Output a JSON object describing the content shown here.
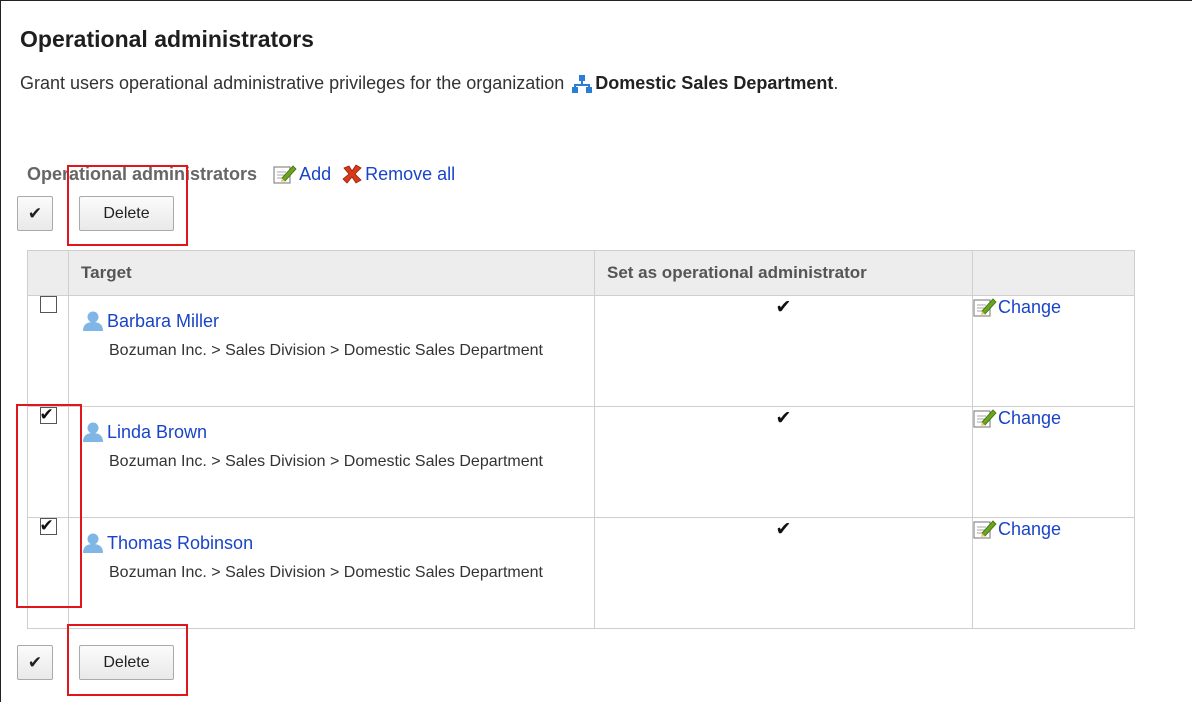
{
  "page": {
    "title": "Operational administrators",
    "description": "Grant users operational administrative privileges for the organization",
    "organization": "Domestic Sales Department",
    "description_end": "."
  },
  "section": {
    "label": "Operational administrators",
    "add_label": "Add",
    "remove_all_label": "Remove all"
  },
  "toolbar": {
    "select_all_label": "✔",
    "delete_label": "Delete"
  },
  "table": {
    "columns": [
      "",
      "Target",
      "Set as operational administrator",
      ""
    ],
    "rows": [
      {
        "checked": false,
        "name": "Barbara Miller",
        "path": "Bozuman Inc. > Sales Division > Domestic Sales Department",
        "set_as_admin": "✔",
        "action": "Change"
      },
      {
        "checked": true,
        "name": "Linda Brown",
        "path": "Bozuman Inc. > Sales Division > Domestic Sales Department",
        "set_as_admin": "✔",
        "action": "Change"
      },
      {
        "checked": true,
        "name": "Thomas Robinson",
        "path": "Bozuman Inc. > Sales Division > Domestic Sales Department",
        "set_as_admin": "✔",
        "action": "Change"
      }
    ]
  },
  "checkbox_mark": "✔",
  "icons": {
    "organization": "org-tree-icon",
    "add": "edit-note-icon",
    "remove_all": "red-x-icon",
    "user": "user-icon",
    "change": "edit-note-icon"
  },
  "colors": {
    "link": "#1a44c8",
    "highlight": "#e0161d",
    "header_bg": "#ededed",
    "org_icon": "#2a7fd4"
  }
}
